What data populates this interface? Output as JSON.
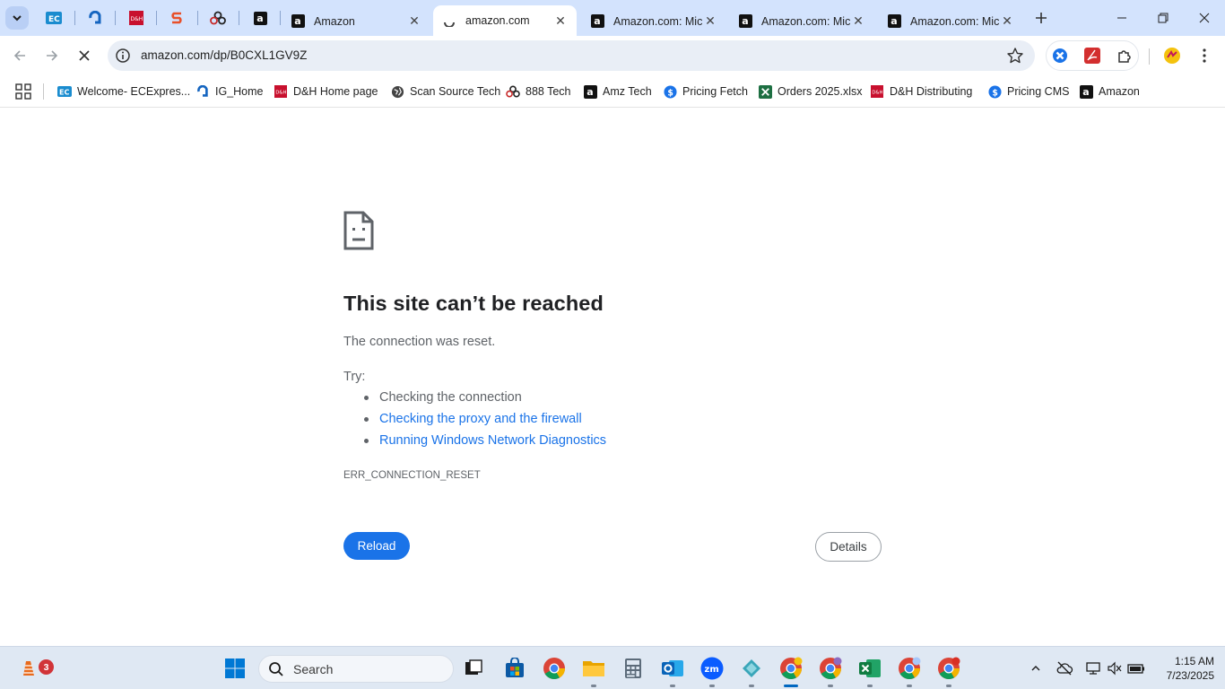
{
  "browser": {
    "tabs": [
      {
        "title": "Amazon",
        "favicon": "amazon-icon",
        "active": false
      },
      {
        "title": "amazon.com",
        "favicon": "loading-spinner-icon",
        "active": true
      },
      {
        "title": "Amazon.com: Mic",
        "favicon": "amazon-icon",
        "active": false
      },
      {
        "title": "Amazon.com: Mic",
        "favicon": "amazon-icon",
        "active": false
      },
      {
        "title": "Amazon.com: Mic",
        "favicon": "amazon-icon",
        "active": false
      }
    ],
    "pinned_tabs": [
      "ec-icon",
      "ig-icon",
      "dh-icon",
      "s-icon",
      "888-icon",
      "amazon-icon"
    ],
    "url": "amazon.com/dp/B0CXL1GV9Z",
    "bookmarks": [
      {
        "label": "Welcome- ECExpres...",
        "icon": "ec-icon"
      },
      {
        "label": "IG_Home",
        "icon": "ig-icon"
      },
      {
        "label": "D&H Home page",
        "icon": "dh-icon"
      },
      {
        "label": "Scan Source Tech",
        "icon": "globe-icon"
      },
      {
        "label": "888 Tech",
        "icon": "888-icon"
      },
      {
        "label": "Amz Tech",
        "icon": "amazon-icon"
      },
      {
        "label": "Pricing Fetch",
        "icon": "dollar-icon"
      },
      {
        "label": "Orders 2025.xlsx",
        "icon": "excel-icon"
      },
      {
        "label": "D&H Distributing",
        "icon": "dh-icon"
      },
      {
        "label": "Pricing CMS",
        "icon": "dollar-icon"
      },
      {
        "label": "Amazon",
        "icon": "amazon-icon"
      }
    ]
  },
  "error_page": {
    "title": "This site can’t be reached",
    "message": "The connection was reset.",
    "try_label": "Try:",
    "suggestions": [
      "Checking the connection",
      "Checking the proxy and the firewall",
      "Running Windows Network Diagnostics"
    ],
    "error_code": "ERR_CONNECTION_RESET",
    "reload_label": "Reload",
    "details_label": "Details"
  },
  "taskbar": {
    "search_placeholder": "Search",
    "widget_badge": "3",
    "time": "1:15 AM",
    "date": "7/23/2025"
  },
  "colors": {
    "tabstrip": "#d3e3fd",
    "link": "#1a73e8",
    "reload_button": "#1a73e8",
    "taskbar": "#dfe8f3"
  }
}
